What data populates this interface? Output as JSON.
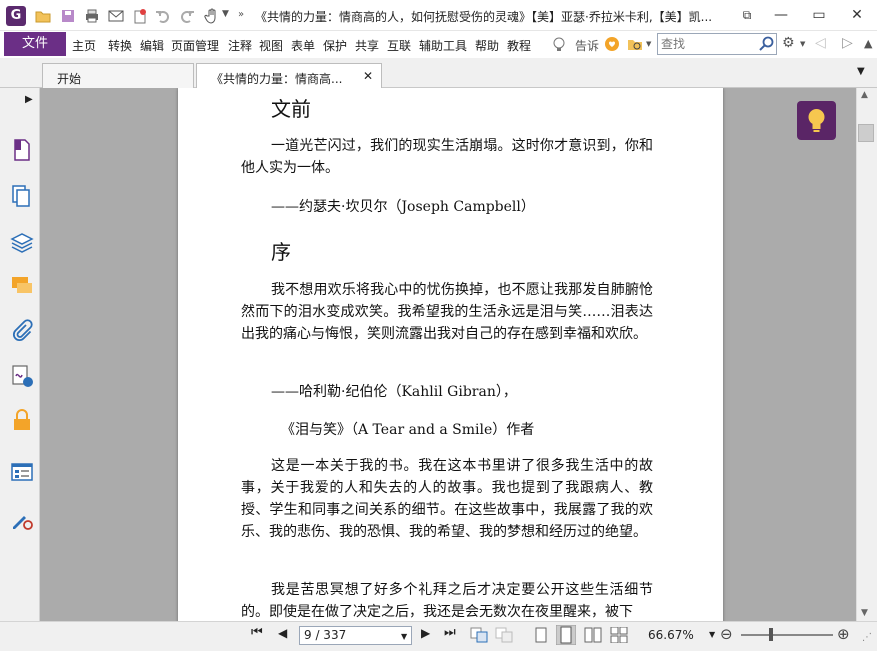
{
  "title": "《共情的力量：情商高的人，如何抚慰受伤的灵魂》【美】亚瑟·乔拉米卡利,【美】凯...",
  "menu": {
    "file": "文件",
    "items": [
      "主页",
      "转换",
      "编辑",
      "页面管理",
      "注释",
      "视图",
      "表单",
      "保护",
      "共享",
      "互联",
      "辅助工具",
      "帮助",
      "教程"
    ],
    "tell_me": "告诉",
    "search_placeholder": "查找"
  },
  "tabs": [
    {
      "label": "开始"
    },
    {
      "label": "《共情的力量：情商高..."
    }
  ],
  "document": {
    "heading1": "文前",
    "para1": "一道光芒闪过，我们的现实生活崩塌。这时你才意识到，你和他人实为一体。",
    "quote1": "——约瑟夫·坎贝尔（Joseph Campbell）",
    "heading2": "序",
    "para2": "我不想用欢乐将我心中的忧伤换掉，也不愿让我那发自肺腑怆然而下的泪水变成欢笑。我希望我的生活永远是泪与笑……泪表达出我的痛心与悔恨，笑则流露出我对自己的存在感到幸福和欢欣。",
    "quote2": "——哈利勒·纪伯伦（Kahlil Gibran），",
    "quote2b": "《泪与笑》（A Tear and a Smile）作者",
    "para3": "这是一本关于我的书。我在这本书里讲了很多我生活中的故事，关于我爱的人和失去的人的故事。我也提到了我跟病人、教授、学生和同事之间关系的细节。在这些故事中，我展露了我的欢乐、我的悲伤、我的恐惧、我的希望、我的梦想和经历过的绝望。",
    "para4": "我是苦思冥想了好多个礼拜之后才决定要公开这些生活细节的。即使是在做了决定之后，我还是会无数次在夜里醒来，被下"
  },
  "status": {
    "page": "9 / 337",
    "zoom": "66.67%"
  },
  "colors": {
    "accent": "#6b2f86",
    "bulb": "#5a2566"
  }
}
